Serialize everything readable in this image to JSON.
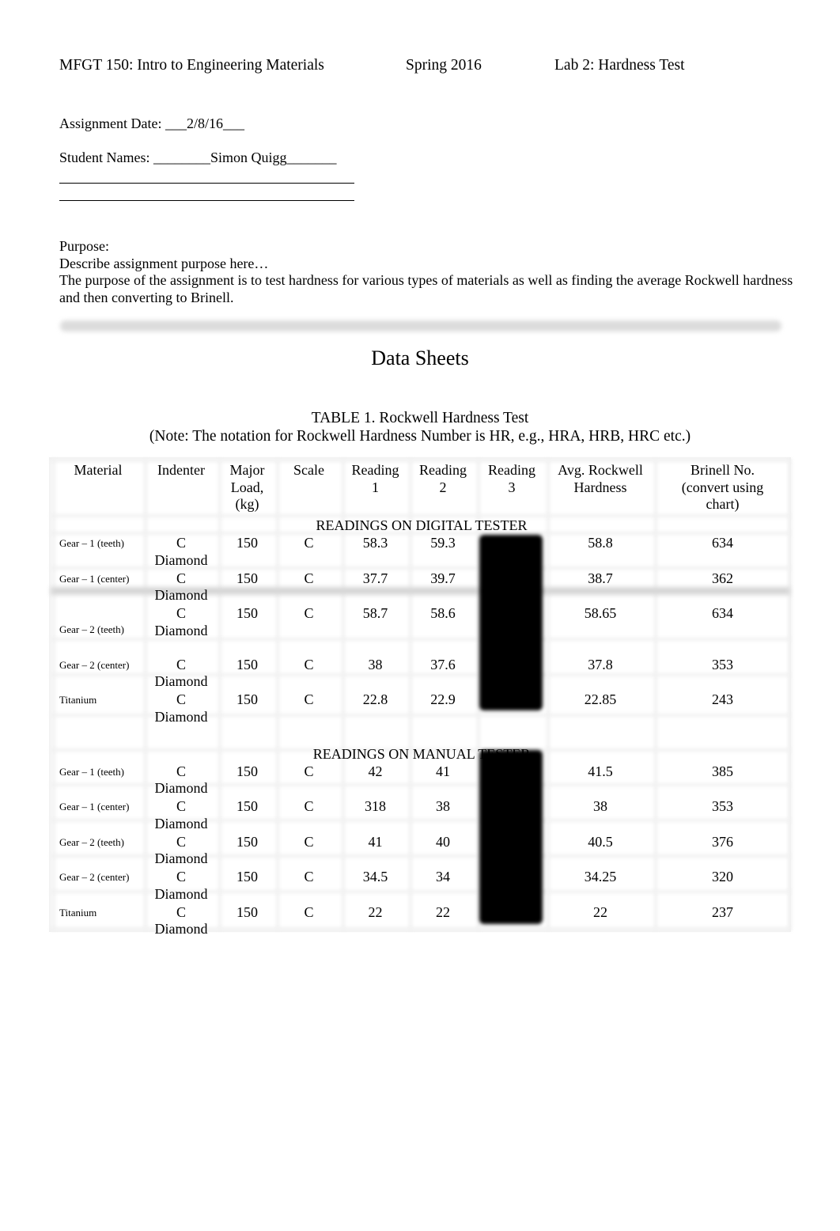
{
  "header": {
    "course": "MFGT 150: Intro to Engineering Materials",
    "term": "Spring 2016",
    "lab": "Lab 2: Hardness Test"
  },
  "assignment": {
    "date_label": "Assignment Date: ",
    "date_value": "___2/8/16___",
    "students_label": "Student Names: ",
    "students_value": "________Simon Quigg_______"
  },
  "purpose": {
    "label": "Purpose:",
    "prompt": "Describe assignment purpose here…",
    "text": "The purpose of the assignment is to test hardness for various types of materials as well as finding the average Rockwell hardness and then converting to Brinell."
  },
  "section_title": "Data Sheets",
  "table": {
    "caption": "TABLE 1. Rockwell Hardness Test",
    "note": "(Note: The notation for Rockwell Hardness Number is HR, e.g., HRA, HRB, HRC etc.)",
    "headers": [
      "Material",
      "Indenter",
      "Major Load, (kg)",
      "Scale",
      "Reading 1",
      "Reading 2",
      "Reading 3",
      "Avg. Rockwell Hardness",
      "Brinell No. (convert using chart)"
    ],
    "header_lines": [
      [
        "Material"
      ],
      [
        "Indenter"
      ],
      [
        "Major",
        "Load,",
        "(kg)"
      ],
      [
        "Scale"
      ],
      [
        "Reading",
        "1"
      ],
      [
        "Reading",
        "2"
      ],
      [
        "Reading",
        "3"
      ],
      [
        "Avg. Rockwell",
        "Hardness"
      ],
      [
        "Brinell No.",
        "(convert using",
        "chart)"
      ]
    ],
    "sections": [
      {
        "title": "READINGS ON DIGITAL TESTER",
        "rows": [
          {
            "material": "Gear – 1 (teeth)",
            "indenter_1": "C",
            "indenter_2": "Diamond",
            "load": "150",
            "scale": "C",
            "r1": "58.3",
            "r2": "59.3",
            "r3": "",
            "avg": "58.8",
            "brinell": "634"
          },
          {
            "material": "Gear – 1 (center)",
            "indenter_1": "C",
            "indenter_2": "Diamond",
            "load": "150",
            "scale": "C",
            "r1": "37.7",
            "r2": "39.7",
            "r3": "",
            "avg": "38.7",
            "brinell": "362"
          },
          {
            "material": "Gear – 2 (teeth)",
            "indenter_1": "C",
            "indenter_2": "Diamond",
            "load": "150",
            "scale": "C",
            "r1": "58.7",
            "r2": "58.6",
            "r3": "",
            "avg": "58.65",
            "brinell": "634"
          },
          {
            "material": "Gear – 2 (center)",
            "indenter_1": "C",
            "indenter_2": "Diamond",
            "load": "150",
            "scale": "C",
            "r1": "38",
            "r2": "37.6",
            "r3": "",
            "avg": "37.8",
            "brinell": "353"
          },
          {
            "material": "Titanium",
            "indenter_1": "C",
            "indenter_2": "Diamond",
            "load": "150",
            "scale": "C",
            "r1": "22.8",
            "r2": "22.9",
            "r3": "",
            "avg": "22.85",
            "brinell": "243"
          }
        ]
      },
      {
        "title": "READINGS ON MANUAL TESTER",
        "rows": [
          {
            "material": "Gear – 1 (teeth)",
            "indenter_1": "C",
            "indenter_2": "Diamond",
            "load": "150",
            "scale": "C",
            "r1": "42",
            "r2": "41",
            "r3": "",
            "avg": "41.5",
            "brinell": "385"
          },
          {
            "material": "Gear – 1 (center)",
            "indenter_1": "C",
            "indenter_2": "Diamond",
            "load": "150",
            "scale": "C",
            "r1": "318",
            "r2": "38",
            "r3": "",
            "avg": "38",
            "brinell": "353"
          },
          {
            "material": "Gear – 2 (teeth)",
            "indenter_1": "C",
            "indenter_2": "Diamond",
            "load": "150",
            "scale": "C",
            "r1": "41",
            "r2": "40",
            "r3": "",
            "avg": "40.5",
            "brinell": "376"
          },
          {
            "material": "Gear – 2 (center)",
            "indenter_1": "C",
            "indenter_2": "Diamond",
            "load": "150",
            "scale": "C",
            "r1": "34.5",
            "r2": "34",
            "r3": "",
            "avg": "34.25",
            "brinell": "320"
          },
          {
            "material": "Titanium",
            "indenter_1": "C",
            "indenter_2": "Diamond",
            "load": "150",
            "scale": "C",
            "r1": "22",
            "r2": "22",
            "r3": "",
            "avg": "22",
            "brinell": "237"
          }
        ]
      }
    ]
  }
}
